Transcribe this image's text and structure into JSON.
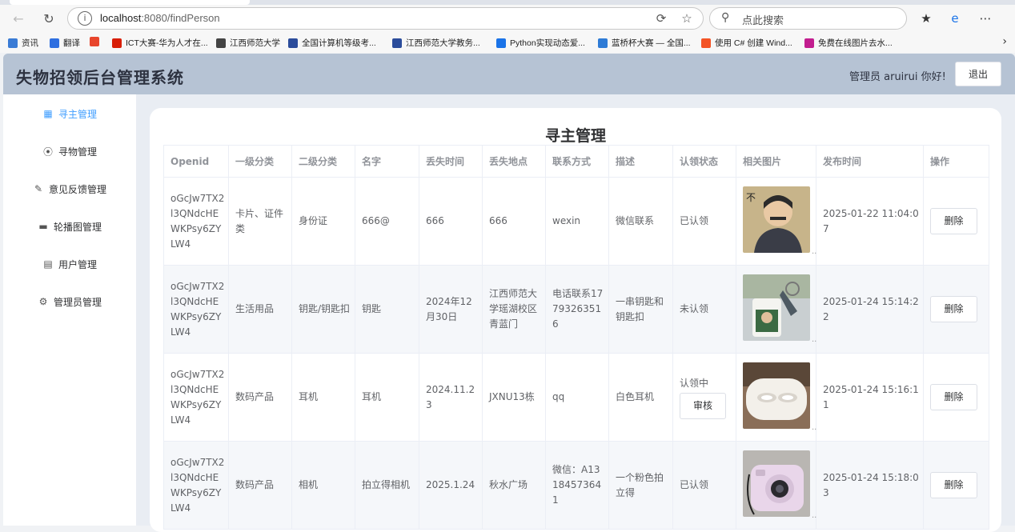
{
  "browser": {
    "url_host": "localhost",
    "url_rest": ":8080/findPerson",
    "search_placeholder": "点此搜索",
    "bookmarks": [
      {
        "label": "资讯",
        "color": "#3a7bd5"
      },
      {
        "label": "翻译",
        "color": "#2f6fe0"
      },
      {
        "label": "",
        "color": "#e8452c"
      },
      {
        "label": "ICT大赛-华为人才在...",
        "color": "#d81e06"
      },
      {
        "label": "江西师范大学",
        "color": "#444444"
      },
      {
        "label": "全国计算机等级考...",
        "color": "#2b4c9b"
      },
      {
        "label": "江西师范大学教务...",
        "color": "#2b4c9b"
      },
      {
        "label": "Python实现动态爱...",
        "color": "#1a73e8"
      },
      {
        "label": "蓝桥杯大赛 — 全国...",
        "color": "#2e7bd6"
      },
      {
        "label": "使用 C# 创建 Wind...",
        "color": "#f35325"
      },
      {
        "label": "免费在线图片去水...",
        "color": "#c21d8f"
      }
    ]
  },
  "header": {
    "title": "失物招领后台管理系统",
    "greeting": "管理员 aruirui 你好!",
    "logout_label": "退出"
  },
  "sidebar": {
    "items": [
      {
        "label": "寻主管理",
        "icon": "grid-icon",
        "active": true
      },
      {
        "label": "寻物管理",
        "icon": "location-icon",
        "active": false
      },
      {
        "label": "意见反馈管理",
        "icon": "edit-icon",
        "active": false
      },
      {
        "label": "轮播图管理",
        "icon": "truck-icon",
        "active": false
      },
      {
        "label": "用户管理",
        "icon": "document-icon",
        "active": false
      },
      {
        "label": "管理员管理",
        "icon": "gear-icon",
        "active": false
      }
    ]
  },
  "main": {
    "title": "寻主管理",
    "columns": [
      "Openid",
      "一级分类",
      "二级分类",
      "名字",
      "丢失时间",
      "丢失地点",
      "联系方式",
      "描述",
      "认领状态",
      "相关图片",
      "发布时间",
      "操作"
    ],
    "delete_label": "删除",
    "review_label": "审核",
    "rows": [
      {
        "openid": "oGcJw7TX2l3QNdcHEWKPsy6ZYLW4",
        "cat1": "卡片、证件类",
        "cat2": "身份证",
        "name": "666@",
        "lost_time": "666",
        "lost_place": "666",
        "contact": "wexin",
        "desc": "微信联系",
        "status": "已认领",
        "image": "cartoon-portrait",
        "publish_time": "2025-01-22 11:04:07",
        "reviewing": false
      },
      {
        "openid": "oGcJw7TX2l3QNdcHEWKPsy6ZYLW4",
        "cat1": "生活用品",
        "cat2": "钥匙/钥匙扣",
        "name": "钥匙",
        "lost_time": "2024年12月30日",
        "lost_place": "江西师范大学瑶湖校区青蓝门",
        "contact": "电话联系17793263516",
        "desc": "一串钥匙和钥匙扣",
        "status": "未认领",
        "image": "keychain",
        "publish_time": "2025-01-24 15:14:22",
        "reviewing": false
      },
      {
        "openid": "oGcJw7TX2l3QNdcHEWKPsy6ZYLW4",
        "cat1": "数码产品",
        "cat2": "耳机",
        "name": "耳机",
        "lost_time": "2024.11.23",
        "lost_place": "JXNU13栋",
        "contact": "qq",
        "desc": "白色耳机",
        "status": "认领中",
        "image": "earbuds-case",
        "publish_time": "2025-01-24 15:16:11",
        "reviewing": true
      },
      {
        "openid": "oGcJw7TX2l3QNdcHEWKPsy6ZYLW4",
        "cat1": "数码产品",
        "cat2": "相机",
        "name": "拍立得相机",
        "lost_time": "2025.1.24",
        "lost_place": "秋水广场",
        "contact": "微信：A13184573641",
        "desc": "一个粉色拍立得",
        "status": "已认领",
        "image": "pink-instant-camera",
        "publish_time": "2025-01-24 15:18:03",
        "reviewing": false
      }
    ]
  }
}
